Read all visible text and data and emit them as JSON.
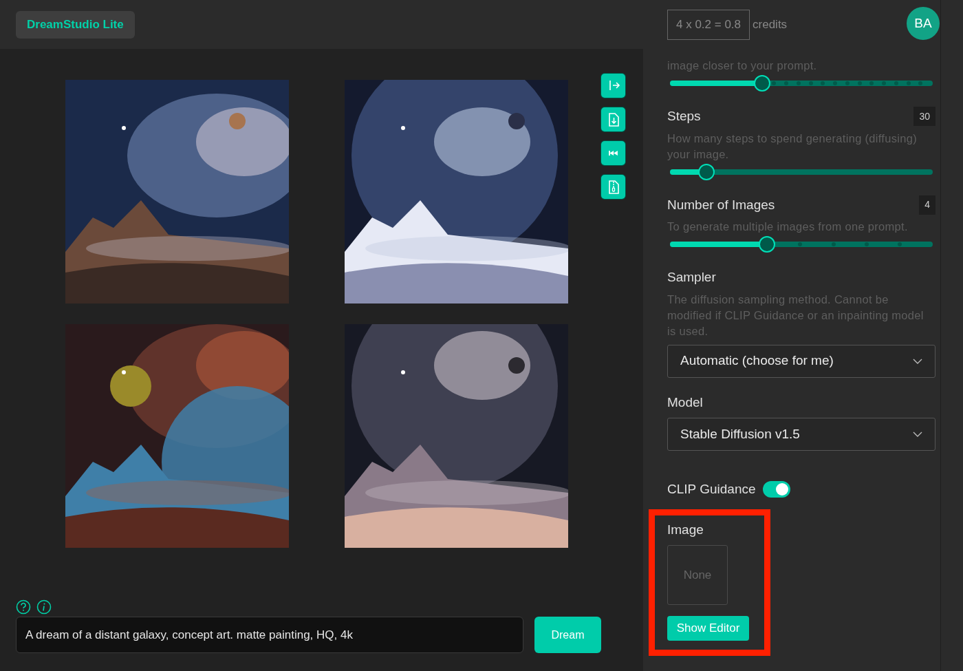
{
  "app": {
    "title": "DreamStudio Lite"
  },
  "toolbar": [
    {
      "kind": "expand"
    },
    {
      "kind": "download"
    },
    {
      "kind": "rewind"
    },
    {
      "kind": "zip"
    }
  ],
  "prompt": {
    "value": "A dream of a distant galaxy, concept art. matte painting, HQ, 4k",
    "button": "Dream"
  },
  "cost": {
    "formula": "4 x 0.2 = 0.8",
    "unit": "credits"
  },
  "user": {
    "initials": "BA"
  },
  "settings": [
    {
      "kind": "slider",
      "description": "image closer to your prompt.",
      "level": 0.35
    },
    {
      "kind": "slider",
      "label": "Steps",
      "reading": "30",
      "description": "How many steps to spend generating (diffusing) your image.",
      "level": 0.14
    },
    {
      "kind": "slider",
      "label": "Number of Images",
      "reading": "4",
      "description": "To generate multiple images from one prompt.",
      "level": 0.37
    },
    {
      "kind": "select",
      "label": "Sampler",
      "description": "The diffusion sampling method. Cannot be modified if CLIP Guidance or an inpainting model is used.",
      "value": "Automatic (choose for me)"
    },
    {
      "kind": "select",
      "label": "Model",
      "value": "Stable Diffusion v1.5"
    },
    {
      "kind": "toggle",
      "label": "CLIP Guidance",
      "on": true
    },
    {
      "label": "Image",
      "empty_text": "None",
      "button": "Show Editor",
      "highlighted": true
    }
  ]
}
